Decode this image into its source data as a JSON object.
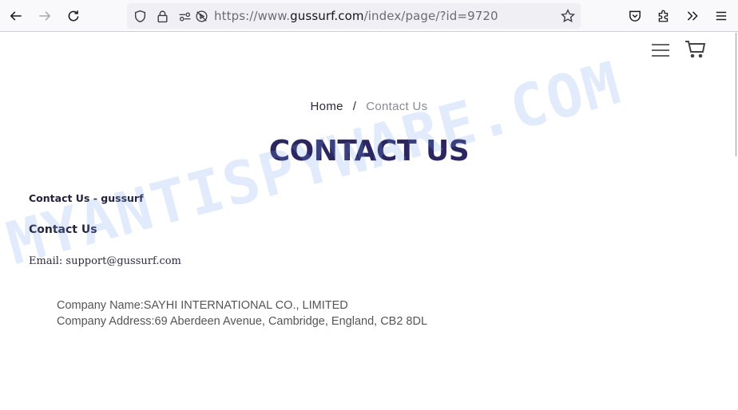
{
  "browser": {
    "url_prefix": "https://www.",
    "url_host": "gussurf.com",
    "url_path": "/index/page/?id=9720",
    "icons": {
      "back": "arrow-left-icon",
      "forward": "arrow-right-icon",
      "reload": "reload-icon",
      "tracking": "shield-icon",
      "security": "lock-icon",
      "permissions": "permissions-icon",
      "autoplay": "autoplay-blocked-icon",
      "bookmark": "star-icon",
      "pocket": "pocket-icon",
      "extensions": "puzzle-icon",
      "overflow": "chevron-double-right-icon",
      "app_menu": "hamburger-icon"
    }
  },
  "site": {
    "header": {
      "menu_icon": "hamburger-menu-icon",
      "cart_icon": "cart-icon"
    },
    "breadcrumb": {
      "home": "Home",
      "separator": "/",
      "current": "Contact Us"
    },
    "title": "CONTACT US",
    "subtitle": "Contact Us - gussurf",
    "section_heading": "Contact Us",
    "email_line": "Email: support@gussurf.com",
    "company_name": "Company Name:SAYHI INTERNATIONAL CO., LIMITED",
    "company_address": "Company Address:69 Aberdeen Avenue, Cambridge, England, CB2 8DL"
  },
  "watermark": "MYANTISPYWARE.COM",
  "colors": {
    "title": "#2b2660",
    "breadcrumb_current": "#8a8a96",
    "watermark": "#78a5f0"
  }
}
